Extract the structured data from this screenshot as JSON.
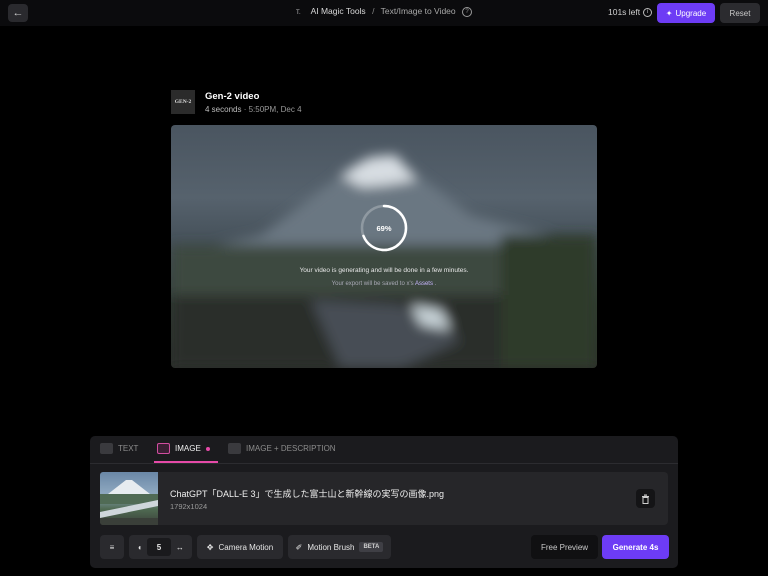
{
  "topbar": {
    "tool_name": "AI Magic Tools",
    "separator": "/",
    "current_page": "Text/Image to Video",
    "credits": "101s left",
    "upgrade_label": "Upgrade",
    "reset_label": "Reset",
    "tool_icon_text": "T."
  },
  "generation": {
    "logo_text": "GEN-2",
    "title": "Gen-2 video",
    "duration": "4 seconds",
    "meta_sep": "·",
    "timestamp": "5:50PM, Dec 4",
    "progress_label": "69%",
    "progress": 0.69,
    "status_text": "Your video is generating and will be done in a few minutes.",
    "export_prefix": "Your export will be saved to x's",
    "export_link": "Assets",
    "export_suffix": "."
  },
  "tabs": [
    {
      "label": "TEXT",
      "active": false
    },
    {
      "label": "IMAGE",
      "active": true
    },
    {
      "label": "IMAGE + DESCRIPTION",
      "active": false
    }
  ],
  "file": {
    "name": "ChatGPT「DALL-E 3」で生成した富士山と新幹線の実写の画像.png",
    "dimensions": "1792x1024"
  },
  "controls": {
    "seconds_value": "5",
    "camera_motion_label": "Camera Motion",
    "motion_brush_label": "Motion Brush",
    "beta_label": "BETA",
    "free_preview_label": "Free Preview",
    "generate_label": "Generate 4s"
  },
  "colors": {
    "accent": "#6d3cf5",
    "tab_active": "#e64aa8"
  }
}
